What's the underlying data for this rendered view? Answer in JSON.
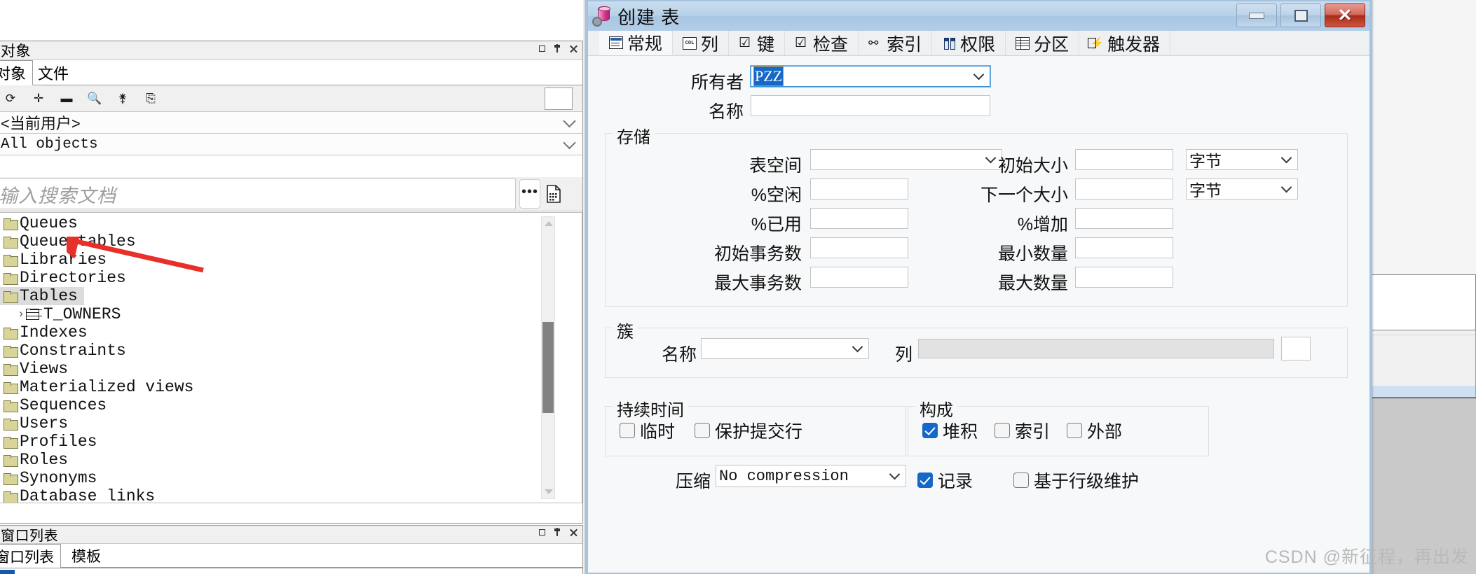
{
  "left_panel": {
    "dock_title": "对象",
    "dock_buttons": [
      "float-icon",
      "pin-icon",
      "close-icon"
    ],
    "tabs": [
      {
        "label": "对象",
        "active": true
      },
      {
        "label": "文件",
        "active": false
      }
    ],
    "toolbar_icons": [
      "refresh-icon",
      "add-icon",
      "remove-icon",
      "find-icon",
      "filter-icon",
      "copy-icon"
    ],
    "user_filter": "<当前用户>",
    "object_filter": "All objects",
    "search": {
      "placeholder": "输入搜索文档",
      "value": ""
    },
    "search_buttons": [
      "more-options-button",
      "document-button"
    ],
    "tree": [
      {
        "label": "Queues",
        "icon": "folder-icon",
        "level": 0,
        "selected": false,
        "expandable": false
      },
      {
        "label": "Queue tables",
        "icon": "folder-icon",
        "level": 0,
        "selected": false,
        "expandable": false
      },
      {
        "label": "Libraries",
        "icon": "folder-icon",
        "level": 0,
        "selected": false,
        "expandable": false
      },
      {
        "label": "Directories",
        "icon": "folder-icon",
        "level": 0,
        "selected": false,
        "expandable": false
      },
      {
        "label": "Tables",
        "icon": "folder-open-icon",
        "level": 0,
        "selected": true,
        "expandable": true
      },
      {
        "label": "T_OWNERS",
        "icon": "table-icon",
        "level": 1,
        "selected": false,
        "expandable": true
      },
      {
        "label": "Indexes",
        "icon": "folder-icon",
        "level": 0,
        "selected": false,
        "expandable": false
      },
      {
        "label": "Constraints",
        "icon": "folder-icon",
        "level": 0,
        "selected": false,
        "expandable": false
      },
      {
        "label": "Views",
        "icon": "folder-icon",
        "level": 0,
        "selected": false,
        "expandable": false
      },
      {
        "label": "Materialized views",
        "icon": "folder-icon",
        "level": 0,
        "selected": false,
        "expandable": false
      },
      {
        "label": "Sequences",
        "icon": "folder-icon",
        "level": 0,
        "selected": false,
        "expandable": false
      },
      {
        "label": "Users",
        "icon": "folder-icon",
        "level": 0,
        "selected": false,
        "expandable": false
      },
      {
        "label": "Profiles",
        "icon": "folder-icon",
        "level": 0,
        "selected": false,
        "expandable": false
      },
      {
        "label": "Roles",
        "icon": "folder-icon",
        "level": 0,
        "selected": false,
        "expandable": false
      },
      {
        "label": "Synonyms",
        "icon": "folder-icon",
        "level": 0,
        "selected": false,
        "expandable": false
      },
      {
        "label": "Database links",
        "icon": "folder-icon",
        "level": 0,
        "selected": false,
        "expandable": false
      }
    ],
    "annotation": {
      "type": "red-arrow",
      "points_to": "Tables",
      "color": "#e8302a"
    }
  },
  "bottom_panel": {
    "dock_title": "窗口列表",
    "tabs": [
      {
        "label": "窗口列表",
        "active": true
      },
      {
        "label": "模板",
        "active": false
      }
    ]
  },
  "dialog": {
    "title": "创建 表",
    "icon": "table-create-icon",
    "window_controls": {
      "minimize": "minimize-icon",
      "restore": "restore-icon",
      "close": "close-icon"
    },
    "tabs": [
      {
        "label": "常规",
        "icon": "general-icon",
        "active": true
      },
      {
        "label": "列",
        "icon": "column-icon",
        "active": false
      },
      {
        "label": "键",
        "icon": "key-check-icon",
        "active": false
      },
      {
        "label": "检查",
        "icon": "check-icon",
        "active": false
      },
      {
        "label": "索引",
        "icon": "index-icon",
        "active": false
      },
      {
        "label": "权限",
        "icon": "permission-icon",
        "active": false
      },
      {
        "label": "分区",
        "icon": "partition-icon",
        "active": false
      },
      {
        "label": "触发器",
        "icon": "trigger-icon",
        "active": false
      }
    ],
    "general": {
      "owner_label": "所有者",
      "owner_value": "PZZ",
      "name_label": "名称",
      "name_value": ""
    },
    "storage": {
      "title": "存储",
      "left_fields": [
        {
          "label": "表空间",
          "value": "",
          "type": "combo"
        },
        {
          "label": "%空闲",
          "value": "",
          "type": "text"
        },
        {
          "label": "%已用",
          "value": "",
          "type": "text"
        },
        {
          "label": "初始事务数",
          "value": "",
          "type": "text"
        },
        {
          "label": "最大事务数",
          "value": "",
          "type": "text"
        }
      ],
      "right_fields": [
        {
          "label": "初始大小",
          "value": "",
          "type": "text",
          "unit": "字节"
        },
        {
          "label": "下一个大小",
          "value": "",
          "type": "text",
          "unit": "字节"
        },
        {
          "label": "%增加",
          "value": "",
          "type": "text",
          "unit": ""
        },
        {
          "label": "最小数量",
          "value": "",
          "type": "text",
          "unit": ""
        },
        {
          "label": "最大数量",
          "value": "",
          "type": "text",
          "unit": ""
        }
      ]
    },
    "cluster": {
      "title": "簇",
      "name_label": "名称",
      "name_value": "",
      "columns_label": "列",
      "columns_value": "",
      "columns_disabled": true,
      "browse_button": ""
    },
    "duration": {
      "title": "持续时间",
      "checkboxes": [
        {
          "label": "临时",
          "checked": false
        },
        {
          "label": "保护提交行",
          "checked": false
        }
      ]
    },
    "organization": {
      "title": "构成",
      "checkboxes": [
        {
          "label": "堆积",
          "checked": true
        },
        {
          "label": "索引",
          "checked": false
        },
        {
          "label": "外部",
          "checked": false
        }
      ]
    },
    "compression": {
      "label": "压缩",
      "value": "No compression"
    },
    "extra_checkboxes": [
      {
        "label": "记录",
        "checked": true
      },
      {
        "label": "基于行级维护",
        "checked": false
      }
    ]
  },
  "watermark": "CSDN @新征程，再出发",
  "colors": {
    "accent": "#1567c8",
    "title_bar": "#b3cde6",
    "close_button": "#a82d19",
    "annotation_red": "#e8302a",
    "selection_blue": "#1567c8"
  }
}
